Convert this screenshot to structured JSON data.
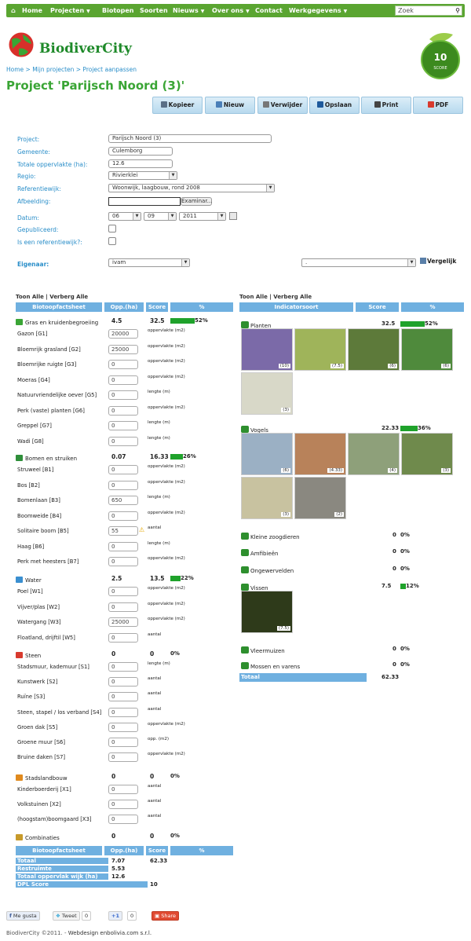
{
  "nav": {
    "items": [
      "Home",
      "Projecten",
      "Biotopen",
      "Soorten",
      "Nieuws",
      "Over ons",
      "Contact",
      "Werkgegevens"
    ],
    "search_placeholder": "Zoek"
  },
  "logo": {
    "text": "BiodiverCity"
  },
  "badge": {
    "score": "10",
    "label": "SCORE"
  },
  "breadcrumb": "Home > Mijn projecten > Project aanpassen",
  "page_title": "Project 'Parijsch Noord (3)'",
  "toolbar": [
    "Kopieer",
    "Nieuw",
    "Verwijder",
    "Opslaan",
    "Print",
    "PDF"
  ],
  "form": {
    "project_label": "Project:",
    "project_value": "Parijsch Noord (3)",
    "gemeente_label": "Gemeente:",
    "gemeente_value": "Culemborg",
    "opp_label": "Totale oppervlakte (ha):",
    "opp_value": "12.6",
    "regio_label": "Regio:",
    "regio_value": "Rivierklei",
    "ref_label": "Referentiewijk:",
    "ref_value": "Woonwijk, laagbouw, rond 2008",
    "afb_label": "Afbeelding:",
    "browse": "Examinar...",
    "datum_label": "Datum:",
    "day": "06",
    "month": "09",
    "year": "2011",
    "gepub_label": "Gepubliceerd:",
    "isref_label": "Is een referentiewijk?:",
    "eig_label": "Eigenaar:",
    "eig_value": "ivam",
    "compare_value": ".",
    "compare_btn": "Vergelijk"
  },
  "left": {
    "toggle": "Toon Alle | Verberg Alle",
    "headers": [
      "Biotoopfactsheet",
      "Opp.(ha)",
      "Score",
      "%"
    ],
    "categories": [
      {
        "name": "Gras en kruidenbegroeiing",
        "opp": "4.5",
        "score": "32.5",
        "pct": "52%",
        "pct_value": 52,
        "color": "#3aa535",
        "rows": [
          {
            "label": "Gazon [G1]",
            "value": "20000",
            "unit": "oppervlakte (m2)"
          },
          {
            "label": "Bloemrijk grasland [G2]",
            "value": "25000",
            "unit": "oppervlakte (m2)"
          },
          {
            "label": "Bloemrijke ruigte [G3]",
            "value": "0",
            "unit": "oppervlakte (m2)"
          },
          {
            "label": "Moeras [G4]",
            "value": "0",
            "unit": "oppervlakte (m2)"
          },
          {
            "label": "Natuurvriendelijke oever [G5]",
            "value": "0",
            "unit": "lengte (m)"
          },
          {
            "label": "Perk (vaste) planten [G6]",
            "value": "0",
            "unit": "oppervlakte (m2)"
          },
          {
            "label": "Greppel [G7]",
            "value": "0",
            "unit": "lengte (m)"
          },
          {
            "label": "Wadi [G8]",
            "value": "0",
            "unit": "lengte (m)"
          }
        ]
      },
      {
        "name": "Bomen en struiken",
        "opp": "0.07",
        "score": "16.33",
        "pct": "26%",
        "pct_value": 26,
        "color": "#2f8f3a",
        "rows": [
          {
            "label": "Struweel [B1]",
            "value": "0",
            "unit": "oppervlakte (m2)"
          },
          {
            "label": "Bos [B2]",
            "value": "0",
            "unit": "oppervlakte (m2)"
          },
          {
            "label": "Bomenlaan [B3]",
            "value": "650",
            "unit": "lengte (m)"
          },
          {
            "label": "Boomweide [B4]",
            "value": "0",
            "unit": "oppervlakte (m2)"
          },
          {
            "label": "Solitaire boom [B5]",
            "value": "55",
            "unit": "aantal"
          },
          {
            "label": "Haag [B6]",
            "value": "0",
            "unit": "lengte (m)"
          },
          {
            "label": "Perk met heesters [B7]",
            "value": "0",
            "unit": "oppervlakte (m2)"
          }
        ]
      },
      {
        "name": "Water",
        "opp": "2.5",
        "score": "13.5",
        "pct": "22%",
        "pct_value": 22,
        "color": "#3a8fd0",
        "rows": [
          {
            "label": "Poel [W1]",
            "value": "0",
            "unit": "oppervlakte (m2)"
          },
          {
            "label": "Vijver/plas [W2]",
            "value": "0",
            "unit": "oppervlakte (m2)"
          },
          {
            "label": "Watergang [W3]",
            "value": "25000",
            "unit": "oppervlakte (m2)"
          },
          {
            "label": "Floatland, drijftil [W5]",
            "value": "0",
            "unit": "aantal"
          }
        ]
      },
      {
        "name": "Steen",
        "opp": "0",
        "score": "0",
        "pct": "0%",
        "pct_value": 0,
        "color": "#d83a2e",
        "rows": [
          {
            "label": "Stadsmuur, kademuur [S1]",
            "value": "0",
            "unit": "lengte (m)"
          },
          {
            "label": "Kunstwerk [S2]",
            "value": "0",
            "unit": "aantal"
          },
          {
            "label": "Ruïne [S3]",
            "value": "0",
            "unit": "aantal"
          },
          {
            "label": "Steen, stapel / los verband [S4]",
            "value": "0",
            "unit": "aantal"
          },
          {
            "label": "Groen dak [S5]",
            "value": "0",
            "unit": "oppervlakte (m2)"
          },
          {
            "label": "Groene muur [S6]",
            "value": "0",
            "unit": "opp. (m2)"
          },
          {
            "label": "Bruine daken [S7]",
            "value": "0",
            "unit": "oppervlakte (m2)"
          }
        ]
      },
      {
        "name": "Stadslandbouw",
        "opp": "0",
        "score": "0",
        "pct": "0%",
        "pct_value": 0,
        "color": "#e08a1e",
        "rows": [
          {
            "label": "Kinderboerderij [X1]",
            "value": "0",
            "unit": "aantal"
          },
          {
            "label": "Volkstuinen [X2]",
            "value": "0",
            "unit": "aantal"
          },
          {
            "label": "(hoogstam)boomgaard [X3]",
            "value": "0",
            "unit": "aantal"
          }
        ]
      },
      {
        "name": "Combinaties",
        "opp": "0",
        "score": "0",
        "pct": "0%",
        "pct_value": 0,
        "color": "#c79a2a",
        "rows": []
      }
    ],
    "summary": [
      {
        "label": "Totaal",
        "a": "7.07",
        "b": "62.33"
      },
      {
        "label": "Restruimte",
        "a": "5.53",
        "b": ""
      },
      {
        "label": "Totaal oppervlak wijk (ha)",
        "a": "12.6",
        "b": ""
      },
      {
        "label": "DPL Score",
        "a": "",
        "b": "10"
      }
    ]
  },
  "right": {
    "toggle": "Toon Alle | Verberg Alle",
    "headers": [
      "Indicatorsoort",
      "Score",
      "%"
    ],
    "groups": [
      {
        "name": "Planten",
        "score": "32.5",
        "pct": "52%",
        "pct_value": 52,
        "photos": [
          {
            "cap": "(10)",
            "bg": "#7b6aa8"
          },
          {
            "cap": "(7.5)",
            "bg": "#9fb45a"
          },
          {
            "cap": "(6)",
            "bg": "#5d7a3a"
          },
          {
            "cap": "(6)",
            "bg": "#4f8a3c"
          },
          {
            "cap": "(3)",
            "bg": "#d8d8c8"
          }
        ]
      },
      {
        "name": "Vogels",
        "score": "22.33",
        "pct": "36%",
        "pct_value": 36,
        "photos": [
          {
            "cap": "(6)",
            "bg": "#9bb0c4"
          },
          {
            "cap": "(4.33)",
            "bg": "#b8825a"
          },
          {
            "cap": "(4)",
            "bg": "#8ea07a"
          },
          {
            "cap": "(3)",
            "bg": "#6f8a4c"
          },
          {
            "cap": "(3)",
            "bg": "#c8c2a0"
          },
          {
            "cap": "(2)",
            "bg": "#8a8880"
          }
        ]
      },
      {
        "name": "Kleine zoogdieren",
        "score": "0",
        "pct": "0%",
        "pct_value": 0,
        "photos": []
      },
      {
        "name": "Amfibieën",
        "score": "0",
        "pct": "0%",
        "pct_value": 0,
        "photos": []
      },
      {
        "name": "Ongewervelden",
        "score": "0",
        "pct": "0%",
        "pct_value": 0,
        "photos": []
      },
      {
        "name": "Vissen",
        "score": "7.5",
        "pct": "12%",
        "pct_value": 12,
        "photos": [
          {
            "cap": "(7.5)",
            "bg": "#2e3a1a"
          }
        ]
      },
      {
        "name": "Vleermuizen",
        "score": "0",
        "pct": "0%",
        "pct_value": 0,
        "photos": []
      },
      {
        "name": "Mossen en varens",
        "score": "0",
        "pct": "0%",
        "pct_value": 0,
        "photos": []
      }
    ],
    "total_label": "Totaal",
    "total_value": "62.33"
  },
  "social": {
    "like": "Me gusta",
    "tweet": "Tweet",
    "tweet_count": "0",
    "plus": "+1",
    "plus_count": "0",
    "share": "Share"
  },
  "footer": {
    "copy": "BiodiverCity ©2011. - ",
    "credit": "Webdesign enbolivia.com s.r.l."
  }
}
